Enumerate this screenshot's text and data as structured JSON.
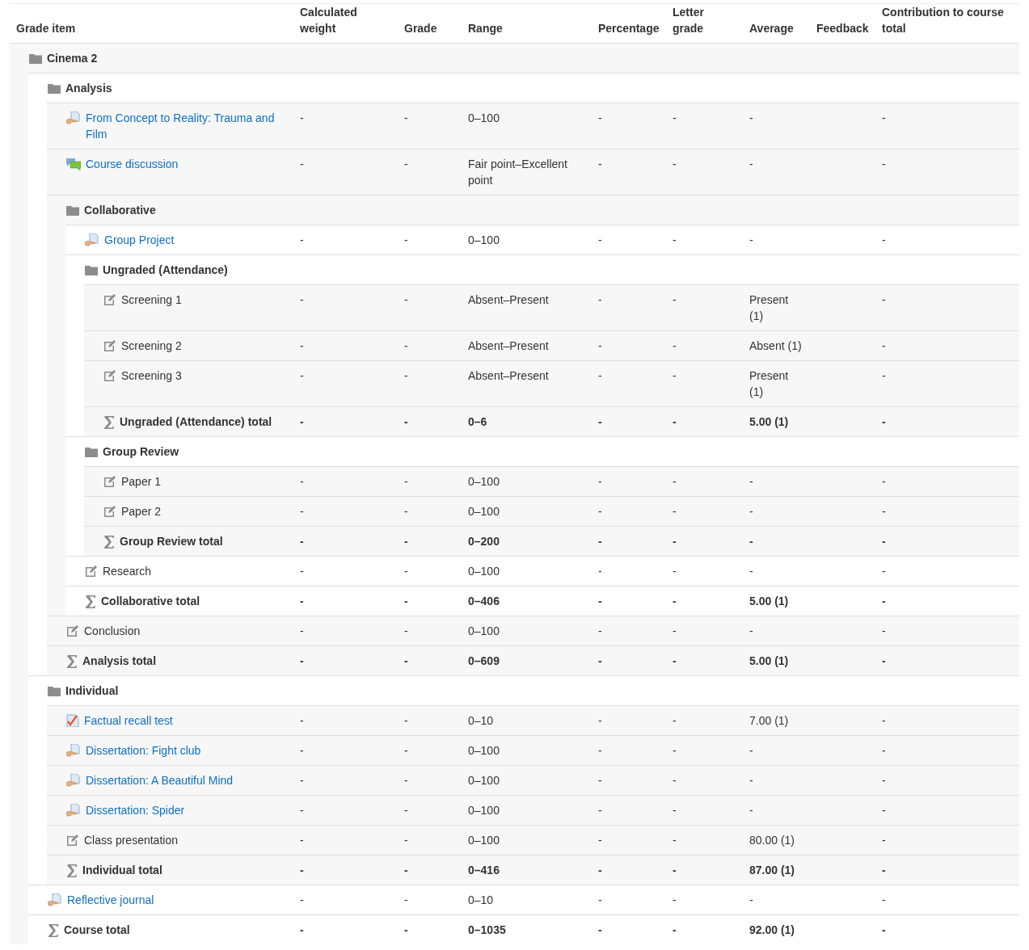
{
  "columns": [
    "Grade item",
    "Calculated weight",
    "Grade",
    "Range",
    "Percentage",
    "Letter grade",
    "Average",
    "Feedback",
    "Contribution to course total"
  ],
  "tree": {
    "kind": "category",
    "name": "Cinema 2",
    "children": [
      {
        "kind": "category",
        "name": "Analysis",
        "children": [
          {
            "kind": "assignment",
            "name": "From Concept to Reality: Trauma and Film",
            "weight": "-",
            "grade": "-",
            "range": "0–100",
            "percentage": "-",
            "letter_grade": "-",
            "average": "-",
            "contribution": "-"
          },
          {
            "kind": "forum",
            "name": "Course discussion",
            "weight": "-",
            "grade": "-",
            "range": "Fair point–Excellent point",
            "percentage": "-",
            "letter_grade": "-",
            "average": "-",
            "contribution": "-"
          },
          {
            "kind": "category",
            "name": "Collaborative",
            "children": [
              {
                "kind": "assignment",
                "name": "Group Project",
                "weight": "-",
                "grade": "-",
                "range": "0–100",
                "percentage": "-",
                "letter_grade": "-",
                "average": "-",
                "contribution": "-"
              },
              {
                "kind": "category",
                "name": "Ungraded (Attendance)",
                "children": [
                  {
                    "kind": "manual",
                    "name": "Screening 1",
                    "weight": "-",
                    "grade": "-",
                    "range": "Absent–Present",
                    "percentage": "-",
                    "letter_grade": "-",
                    "average": "Present (1)",
                    "contribution": "-"
                  },
                  {
                    "kind": "manual",
                    "name": "Screening 2",
                    "weight": "-",
                    "grade": "-",
                    "range": "Absent–Present",
                    "percentage": "-",
                    "letter_grade": "-",
                    "average": "Absent (1)",
                    "contribution": "-"
                  },
                  {
                    "kind": "manual",
                    "name": "Screening 3",
                    "weight": "-",
                    "grade": "-",
                    "range": "Absent–Present",
                    "percentage": "-",
                    "letter_grade": "-",
                    "average": "Present (1)",
                    "contribution": "-"
                  },
                  {
                    "kind": "total",
                    "name": "Ungraded (Attendance) total",
                    "weight": "-",
                    "grade": "-",
                    "range": "0–6",
                    "percentage": "-",
                    "letter_grade": "-",
                    "average": "5.00 (1)",
                    "contribution": "-"
                  }
                ]
              },
              {
                "kind": "category",
                "name": "Group Review",
                "children": [
                  {
                    "kind": "manual",
                    "name": "Paper 1",
                    "weight": "-",
                    "grade": "-",
                    "range": "0–100",
                    "percentage": "-",
                    "letter_grade": "-",
                    "average": "-",
                    "contribution": "-"
                  },
                  {
                    "kind": "manual",
                    "name": "Paper 2",
                    "weight": "-",
                    "grade": "-",
                    "range": "0–100",
                    "percentage": "-",
                    "letter_grade": "-",
                    "average": "-",
                    "contribution": "-"
                  },
                  {
                    "kind": "total",
                    "name": "Group Review total",
                    "weight": "-",
                    "grade": "-",
                    "range": "0–200",
                    "percentage": "-",
                    "letter_grade": "-",
                    "average": "-",
                    "contribution": "-"
                  }
                ]
              },
              {
                "kind": "manual",
                "name": "Research",
                "weight": "-",
                "grade": "-",
                "range": "0–100",
                "percentage": "-",
                "letter_grade": "-",
                "average": "-",
                "contribution": "-"
              },
              {
                "kind": "total",
                "name": "Collaborative total",
                "weight": "-",
                "grade": "-",
                "range": "0–406",
                "percentage": "-",
                "letter_grade": "-",
                "average": "5.00 (1)",
                "contribution": "-"
              }
            ]
          },
          {
            "kind": "manual",
            "name": "Conclusion",
            "weight": "-",
            "grade": "-",
            "range": "0–100",
            "percentage": "-",
            "letter_grade": "-",
            "average": "-",
            "contribution": "-"
          },
          {
            "kind": "total",
            "name": "Analysis total",
            "weight": "-",
            "grade": "-",
            "range": "0–609",
            "percentage": "-",
            "letter_grade": "-",
            "average": "5.00 (1)",
            "contribution": "-"
          }
        ]
      },
      {
        "kind": "category",
        "name": "Individual",
        "children": [
          {
            "kind": "quiz",
            "name": "Factual recall test",
            "weight": "-",
            "grade": "-",
            "range": "0–10",
            "percentage": "-",
            "letter_grade": "-",
            "average": "7.00 (1)",
            "contribution": "-"
          },
          {
            "kind": "assignment",
            "name": "Dissertation: Fight club",
            "weight": "-",
            "grade": "-",
            "range": "0–100",
            "percentage": "-",
            "letter_grade": "-",
            "average": "-",
            "contribution": "-"
          },
          {
            "kind": "assignment",
            "name": "Dissertation: A Beautiful Mind",
            "weight": "-",
            "grade": "-",
            "range": "0–100",
            "percentage": "-",
            "letter_grade": "-",
            "average": "-",
            "contribution": "-"
          },
          {
            "kind": "assignment",
            "name": "Dissertation: Spider",
            "weight": "-",
            "grade": "-",
            "range": "0–100",
            "percentage": "-",
            "letter_grade": "-",
            "average": "-",
            "contribution": "-"
          },
          {
            "kind": "manual",
            "name": "Class presentation",
            "weight": "-",
            "grade": "-",
            "range": "0–100",
            "percentage": "-",
            "letter_grade": "-",
            "average": "80.00 (1)",
            "contribution": "-"
          },
          {
            "kind": "total",
            "name": "Individual total",
            "weight": "-",
            "grade": "-",
            "range": "0–416",
            "percentage": "-",
            "letter_grade": "-",
            "average": "87.00 (1)",
            "contribution": "-"
          }
        ]
      },
      {
        "kind": "assignment",
        "name": "Reflective journal",
        "weight": "-",
        "grade": "-",
        "range": "0–10",
        "percentage": "-",
        "letter_grade": "-",
        "average": "-",
        "contribution": "-"
      },
      {
        "kind": "total",
        "name": "Course total",
        "weight": "-",
        "grade": "-",
        "range": "0–1035",
        "percentage": "-",
        "letter_grade": "-",
        "average": "92.00 (1)",
        "contribution": "-"
      }
    ]
  }
}
